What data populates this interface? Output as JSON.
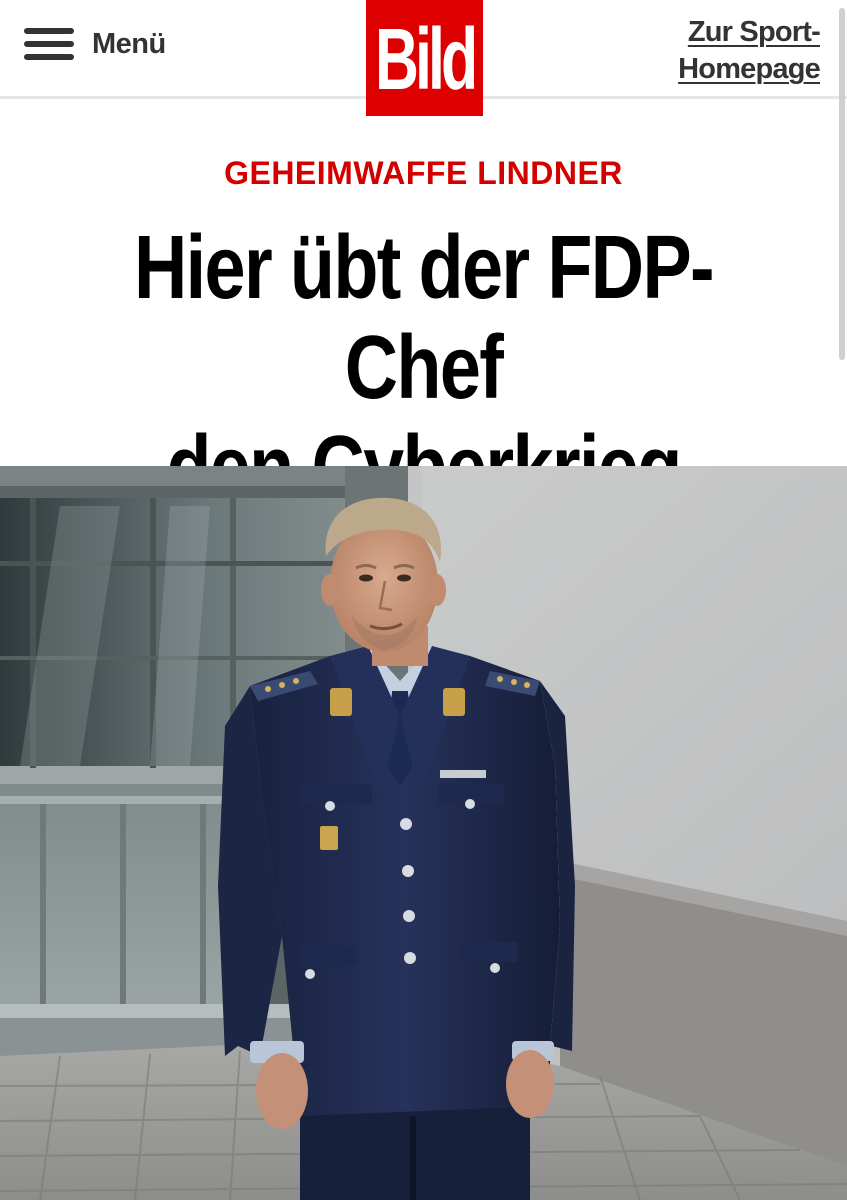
{
  "header": {
    "menu_label": "Menü",
    "logo_text": "Bild",
    "sport_link_line1": "Zur Sport-",
    "sport_link_line2": "Homepage"
  },
  "article": {
    "kicker": "GEHEIMWAFFE LINDNER",
    "headline_line1": "Hier übt der FDP-Chef",
    "headline_line2": "den Cyberkrieg"
  },
  "colors": {
    "brand_red": "#dd0000",
    "kicker_red": "#d40000"
  },
  "icons": {
    "menu": "hamburger-icon"
  }
}
